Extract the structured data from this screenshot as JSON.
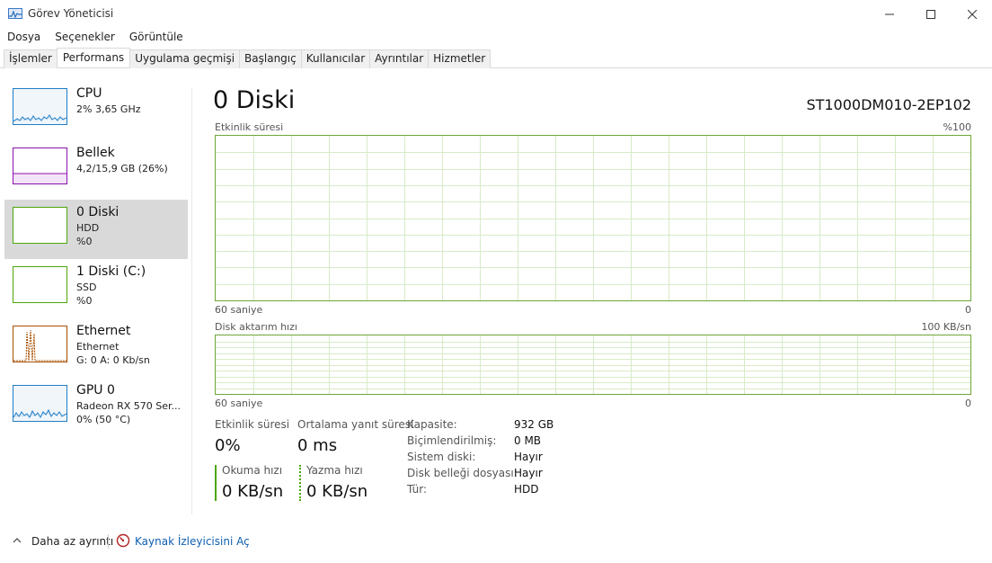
{
  "window": {
    "title": "Görev Yöneticisi"
  },
  "menu": [
    "Dosya",
    "Seçenekler",
    "Görüntüle"
  ],
  "tabs": [
    "İşlemler",
    "Performans",
    "Uygulama geçmişi",
    "Başlangıç",
    "Kullanıcılar",
    "Ayrıntılar",
    "Hizmetler"
  ],
  "active_tab": "Performans",
  "sidebar": [
    {
      "title": "CPU",
      "line1": "2%  3,65 GHz",
      "line2": "",
      "color": "#1e7ec8"
    },
    {
      "title": "Bellek",
      "line1": "4,2/15,9 GB (26%)",
      "line2": "",
      "color": "#8b12ae"
    },
    {
      "title": "0 Diski",
      "line1": "HDD",
      "line2": "%0",
      "color": "#4da60c"
    },
    {
      "title": "1 Diski (C:)",
      "line1": "SSD",
      "line2": "%0",
      "color": "#4da60c"
    },
    {
      "title": "Ethernet",
      "line1": "Ethernet",
      "line2": "G: 0 A: 0 Kb/sn",
      "color": "#a74f01"
    },
    {
      "title": "GPU 0",
      "line1": "Radeon RX 570 Ser...",
      "line2": "0% (50 °C)",
      "color": "#1e7ec8"
    }
  ],
  "selected_index": 2,
  "main": {
    "title": "0 Diski",
    "model": "ST1000DM010-2EP102",
    "chart1": {
      "label": "Etkinlik süresi",
      "max": "%100",
      "time": "60 saniye",
      "min": "0"
    },
    "chart2": {
      "label": "Disk aktarım hızı",
      "max": "100 KB/sn",
      "time": "60 saniye",
      "min": "0"
    }
  },
  "stats": {
    "active_label": "Etkinlik süresi",
    "active_value": "0%",
    "response_label": "Ortalama yanıt süresi",
    "response_value": "0 ms",
    "read_label": "Okuma hızı",
    "read_value": "0 KB/sn",
    "write_label": "Yazma hızı",
    "write_value": "0 KB/sn"
  },
  "details": [
    {
      "key": "Kapasite:",
      "value": "932 GB"
    },
    {
      "key": "Biçimlendirilmiş:",
      "value": "0 MB"
    },
    {
      "key": "Sistem diski:",
      "value": "Hayır"
    },
    {
      "key": "Disk belleği dosyası:",
      "value": "Hayır"
    },
    {
      "key": "Tür:",
      "value": "HDD"
    }
  ],
  "footer": {
    "fewer_details": "Daha az ayrıntı",
    "resource_monitor": "Kaynak İzleyicisini Aç"
  }
}
